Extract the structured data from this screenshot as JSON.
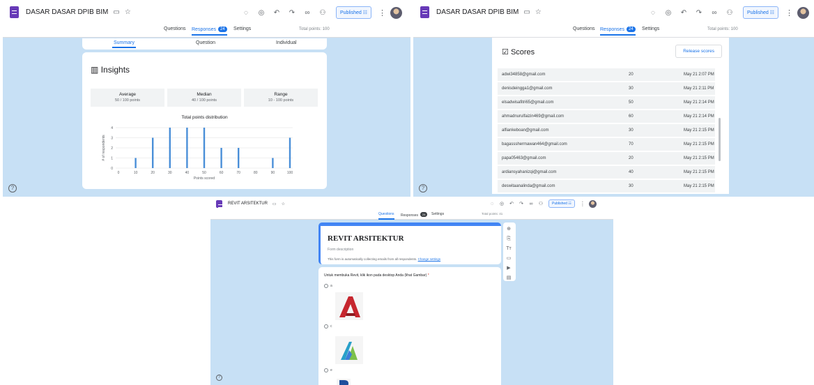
{
  "left_window": {
    "form_title": "DASAR DASAR DPIB BIM",
    "folder_icon": "folder-icon",
    "star_icon": "star-icon",
    "toolbar_icons": [
      "palette-icon",
      "eye-icon",
      "undo-icon",
      "redo-icon",
      "link-icon",
      "add-person-icon"
    ],
    "published_label": "Published",
    "tabs": {
      "questions": "Questions",
      "responses": "Responses",
      "responses_count": "24",
      "settings": "Settings"
    },
    "total_points": "Total points: 100",
    "subtabs": [
      "Summary",
      "Question",
      "Individual"
    ],
    "insights_title": "Insights",
    "stats": [
      {
        "label": "Average",
        "value": "50 / 100 points"
      },
      {
        "label": "Median",
        "value": "40 / 100 points"
      },
      {
        "label": "Range",
        "value": "10 - 100 points"
      }
    ],
    "chart_data": {
      "type": "bar",
      "title": "Total points distribution",
      "xlabel": "Points scored",
      "ylabel": "# of respondents",
      "categories": [
        "0",
        "10",
        "20",
        "30",
        "40",
        "50",
        "60",
        "70",
        "80",
        "90",
        "100"
      ],
      "values": [
        0,
        1,
        3,
        4,
        4,
        4,
        2,
        2,
        0,
        1,
        3
      ],
      "yticks": [
        "0",
        "1",
        "2",
        "3",
        "4"
      ],
      "ylim": [
        0,
        4
      ],
      "bar_color": "#4a8fd8"
    }
  },
  "right_window": {
    "form_title": "DASAR DASAR DPIB BIM",
    "published_label": "Published",
    "tabs": {
      "questions": "Questions",
      "responses": "Responses",
      "responses_count": "24",
      "settings": "Settings"
    },
    "total_points": "Total points: 100",
    "scores_title": "Scores",
    "release_label": "Release scores",
    "rows": [
      {
        "email": "adwi34858@gmail.com",
        "score": "20",
        "time": "May 21 2:07 PM"
      },
      {
        "email": "denisdeingga1@gmail.com",
        "score": "30",
        "time": "May 21 2:11 PM"
      },
      {
        "email": "elsadwisafitri65@gmail.com",
        "score": "50",
        "time": "May 21 2:14 PM"
      },
      {
        "email": "ahmadnurulfaizin469@gmail.com",
        "score": "60",
        "time": "May 21 2:14 PM"
      },
      {
        "email": "alfiankeboan@gmail.com",
        "score": "30",
        "time": "May 21 2:15 PM"
      },
      {
        "email": "bagassshermawan464@gmail.com",
        "score": "70",
        "time": "May 21 2:15 PM"
      },
      {
        "email": "papa05463@gmail.com",
        "score": "20",
        "time": "May 21 2:15 PM"
      },
      {
        "email": "ardiansyahanizqi@gmail.com",
        "score": "40",
        "time": "May 21 2:15 PM"
      },
      {
        "email": "deswitaanalinda@gmail.com",
        "score": "30",
        "time": "May 21 2:15 PM"
      }
    ]
  },
  "bottom_window": {
    "form_title": "REVIT ARSITEKTUR",
    "published_label": "Published",
    "tabs": {
      "questions": "Questions",
      "responses": "Responses",
      "responses_count": "24",
      "settings": "Settings"
    },
    "total_points": "Total points: 41",
    "header_title": "REVIT ARSITEKTUR",
    "description_placeholder": "Form description",
    "notice": "This form is automatically collecting emails from all respondents.",
    "notice_link": "Change settings",
    "question": "Untuk membuka Revit, klik ikon pada desktop Anda (lihat Gambar)",
    "required_mark": "*",
    "options": [
      "a",
      "c",
      "e"
    ],
    "side_tools": [
      "add-question-icon",
      "import-icon",
      "title-text-icon",
      "image-icon",
      "video-icon",
      "section-icon"
    ]
  }
}
